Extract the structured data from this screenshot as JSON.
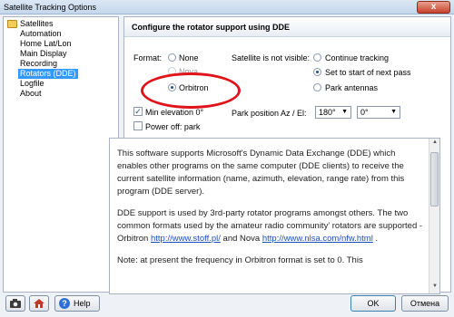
{
  "window": {
    "title": "Satellite Tracking Options",
    "close_label": "x"
  },
  "tree": {
    "root": "Satellites",
    "items": [
      "Automation",
      "Home Lat/Lon",
      "Main Display",
      "Recording",
      "Rotators (DDE)",
      "Logfile",
      "About"
    ],
    "selected_index": 4
  },
  "panel": {
    "header": "Configure the rotator support using DDE",
    "format_label": "Format:",
    "format_options": [
      "None",
      "Nova",
      "Orbitron"
    ],
    "format_selected": "Orbitron",
    "satellite_label": "Satellite is not visible:",
    "sat_options": [
      "Continue tracking",
      "Set to start of next pass",
      "Park antennas"
    ],
    "sat_selected": "Set to start of next pass",
    "min_elevation_label": "Min elevation 0°",
    "min_elevation_checked": true,
    "power_off_label": "Power off: park",
    "power_off_checked": false,
    "park_label": "Park position Az / El:",
    "park_az": "180°",
    "park_el": "0°"
  },
  "description": {
    "p1": "This software supports Microsoft's Dynamic Data Exchange (DDE) which enables other programs on the same computer (DDE clients) to receive the current satellite information (name, azimuth, elevation, range rate) from this program (DDE server).",
    "p2_pre": "DDE support is used by 3rd-party rotator programs amongst others. The two common formats used by the amateur radio community' rotators are supported - Orbitron ",
    "p2_link1": "http://www.stoff.pl/",
    "p2_mid": " and Nova ",
    "p2_link2": "http://www.nlsa.com/nfw.html",
    "p2_post": " .",
    "p3": "Note: at present the frequency in Orbitron format is set to 0. This"
  },
  "footer": {
    "help_label": "Help",
    "ok_label": "OK",
    "cancel_label": "Отмена"
  },
  "colors": {
    "annotation": "#e0131a",
    "selection": "#3399ff"
  }
}
